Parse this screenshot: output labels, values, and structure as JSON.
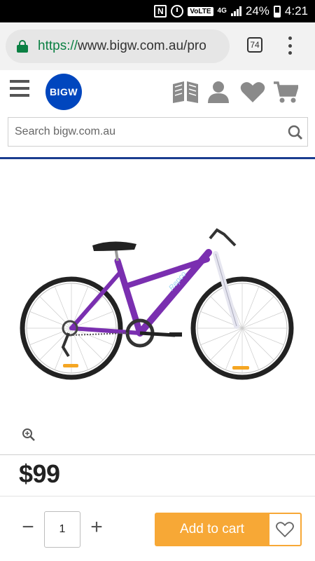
{
  "status_bar": {
    "network": "4G",
    "volte": "VoLTE",
    "battery": "24%",
    "time": "4:21"
  },
  "browser": {
    "url_scheme": "https://",
    "url_rest": "www.bigw.com.au/pro",
    "tab_count": "74"
  },
  "header": {
    "logo": "BIGW",
    "search_placeholder": "Search bigw.com.au"
  },
  "product": {
    "price": "$99",
    "bike_decal": "Repco",
    "frame_color": "#7a2fb0"
  },
  "purchase": {
    "minus_label": "−",
    "quantity": "1",
    "plus_label": "+",
    "add_to_cart_label": "Add to cart",
    "accent_color": "#f7a836"
  }
}
